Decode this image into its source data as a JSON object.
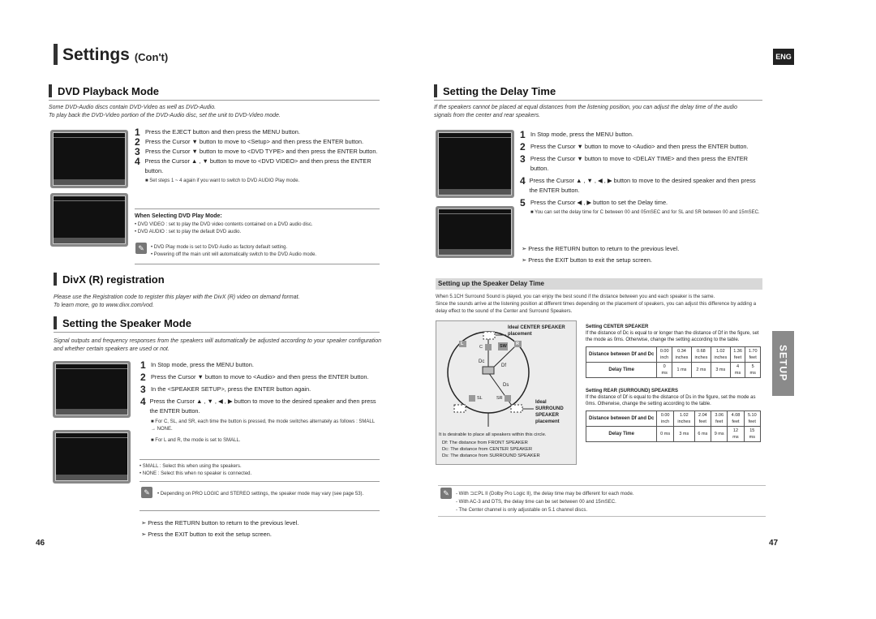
{
  "header": {
    "title": "Settings",
    "subtitle": "(Con't)",
    "lang": "ENG"
  },
  "side_tab": "SETUP",
  "pages": {
    "left": "46",
    "right": "47"
  },
  "dvd": {
    "heading": "DVD Playback Mode",
    "intro": [
      "Some DVD-Audio discs contain DVD-Video as well as DVD-Audio.",
      "To play back the DVD-Video portion of the DVD-Audio disc, set the unit to DVD-Video mode."
    ],
    "steps": [
      {
        "n": "1",
        "t": "Press the EJECT button and then press the MENU button."
      },
      {
        "n": "2",
        "t": "Press the Cursor ▼ button to move to <Setup> and then press the ENTER button."
      },
      {
        "n": "3",
        "t": "Press the Cursor ▼ button to move to <DVD TYPE> and then press the ENTER button."
      },
      {
        "n": "4",
        "t": "Press the Cursor ▲ , ▼ button to move to <DVD VIDEO> and then press the ENTER button."
      }
    ],
    "step_note": "■  Set steps 1 ~ 4 again if you want to switch to DVD AUDIO Play mode.",
    "select_title": "When Selecting DVD Play Mode:",
    "select_items": [
      "• DVD VIDEO : set to play the DVD video contents contained on a DVD audio disc.",
      "• DVD AUDIO : set to play the default DVD audio."
    ],
    "notes": [
      "• DVD Play mode is set to DVD Audio as factory default setting.",
      "• Powering off the main unit will automatically switch to the DVD Audio mode."
    ]
  },
  "divx": {
    "heading": "DivX (R) registration",
    "text": [
      "Please use the Registration code to register this player with the DivX (R) video on demand format.",
      "To learn more, go to www.divx.com/vod."
    ]
  },
  "speaker_mode": {
    "heading": "Setting the Speaker Mode",
    "intro": "Signal outputs and frequency responses from the speakers will automatically be adjusted according to your speaker configuration and whether certain speakers are used or not.",
    "steps": [
      {
        "n": "1",
        "t": "In Stop mode, press the MENU button."
      },
      {
        "n": "2",
        "t": "Press the Cursor ▼ button to move to <Audio> and then press the ENTER button."
      },
      {
        "n": "3",
        "t": "In the <SPEAKER SETUP>, press the ENTER button again."
      },
      {
        "n": "4",
        "t": "Press the Cursor ▲ , ▼ , ◀ , ▶ button to move to the desired speaker and then press the ENTER button."
      }
    ],
    "sub": [
      "■  For C, SL, and SR, each time the button is pressed, the mode switches alternately as follows : SMALL → NONE.",
      "■  For L and R, the mode is set to SMALL."
    ],
    "bullets": [
      "• SMALL : Select this when using the speakers.",
      "• NONE : Select this when no speaker is connected."
    ],
    "note": "• Depending on PRO LOGIC and STEREO settings, the speaker mode may vary (see page 53).",
    "arrows": [
      "Press the RETURN button to return to the previous level.",
      "Press the EXIT button to exit the setup screen."
    ]
  },
  "delay": {
    "heading": "Setting the Delay Time",
    "intro": [
      "If the speakers cannot be placed at equal distances from the listening position, you can adjust the delay time of the audio",
      "signals from the center and rear speakers."
    ],
    "steps": [
      {
        "n": "1",
        "t": "In Stop mode, press the MENU button."
      },
      {
        "n": "2",
        "t": "Press the Cursor ▼ button to move to <Audio> and then press the ENTER button."
      },
      {
        "n": "3",
        "t": "Press the Cursor ▼ button to move to <DELAY TIME> and then press the ENTER button."
      },
      {
        "n": "4",
        "t": "Press the Cursor ▲ , ▼ , ◀ , ▶ button to move to the desired speaker and then press the ENTER button."
      },
      {
        "n": "5",
        "t": "Press the Cursor ◀ , ▶ button to set the Delay time."
      }
    ],
    "sub": "■  You can set the delay time for C between 00 and 05mSEC and for SL and SR between 00 and 15mSEC.",
    "arrows": [
      "Press the RETURN button to return to the previous level.",
      "Press the EXIT button to exit the setup screen."
    ],
    "band": "Setting up the Speaker Delay Time",
    "para": [
      "When 5.1CH Surround Sound is played, you can enjoy the best sound if the distance between you and each speaker is the same.",
      "Since the sounds arrive at the listening position at different times depending on the placement of speakers, you can adjust this difference by adding a delay effect to the sound of the Center and Surround Speakers."
    ],
    "diagram": {
      "center_label": "Ideal CENTER SPEAKER placement",
      "surround_label": "Ideal SURROUND SPEAKER placement",
      "labels": [
        "L",
        "C",
        "SW",
        "R",
        "Dc",
        "Df",
        "Ds",
        "SL",
        "SR"
      ],
      "caption": "It is desirable to place all speakers within this circle.",
      "defs": [
        "Df: The distance from FRONT SPEAKER",
        "Dc: The distance from CENTER SPEAKER",
        "Ds: The distance from SURROUND SPEAKER"
      ]
    },
    "center": {
      "title": "Setting CENTER SPEAKER",
      "text": "If the distance of Dc is equal to or longer than the distance of Df in the figure, set the mode as 0ms. Otherwise, change the setting according to the table.",
      "row1_head": "Distance between Df and Dc",
      "row1": [
        "0.00 inch",
        "0.34 inches",
        "0.68 inches",
        "1.02 inches",
        "1.36 feet",
        "1.70 feet"
      ],
      "row2_head": "Delay Time",
      "row2": [
        "0 ms",
        "1 ms",
        "2 ms",
        "3 ms",
        "4 ms",
        "5 ms"
      ]
    },
    "rear": {
      "title": "Setting REAR (SURROUND) SPEAKERS",
      "text": "If the distance of Df is equal to the distance of Ds in the figure, set the mode as 0ms. Otherwise, change the setting according to the table.",
      "row1_head": "Distance between Df and Dc",
      "row1": [
        "0.00 inch",
        "1.02 inches",
        "2.04 feet",
        "3.06 feet",
        "4.08 feet",
        "5.10 feet"
      ],
      "row2_head": "Delay Time",
      "row2": [
        "0 ms",
        "3 ms",
        "6 ms",
        "9 ms",
        "12 ms",
        "15 ms"
      ]
    },
    "notes": [
      "- With ⊐⊏PL II (Dolby Pro Logic II), the delay time may be different for each mode.",
      "- With AC-3 and DTS, the delay time can be set between 00 and 15mSEC.",
      "- The Center channel is only adjustable on 5.1 channel discs."
    ]
  }
}
